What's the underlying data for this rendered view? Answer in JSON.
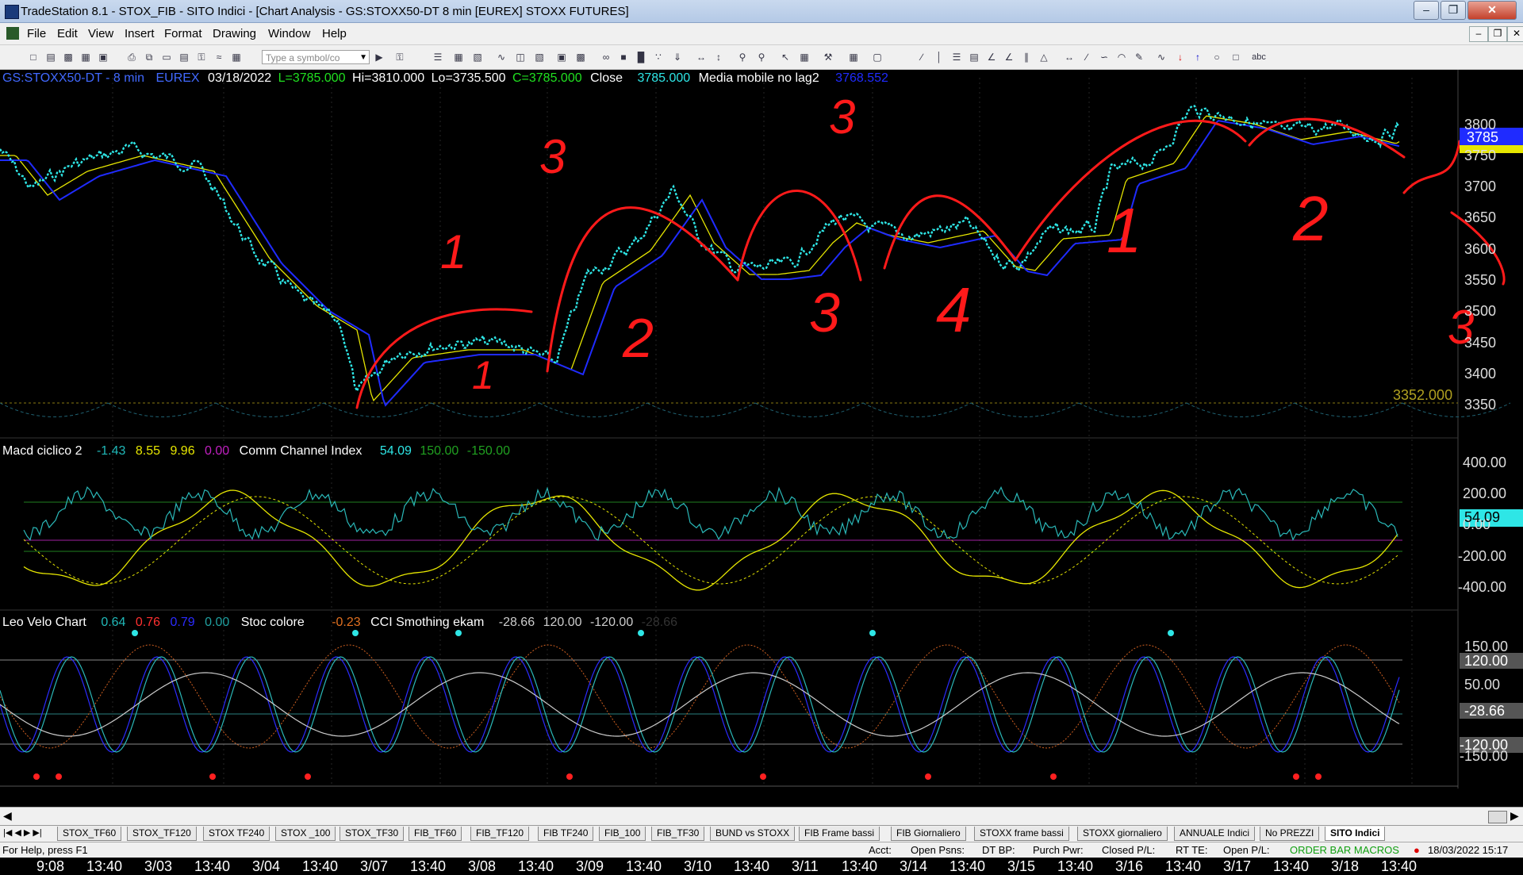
{
  "window": {
    "title": "TradeStation 8.1 - STOX_FIB - SITO Indici - [Chart Analysis - GS:STOXX50-DT  8 min  [EUREX] STOXX FUTURES]"
  },
  "menu": [
    "File",
    "Edit",
    "View",
    "Insert",
    "Format",
    "Drawing",
    "Window",
    "Help"
  ],
  "toolbar": {
    "symbol_placeholder": "Type a symbol/co"
  },
  "price_header": {
    "symbol": "GS:STOXX50-DT - 8 min",
    "exchange": "EUREX",
    "date": "03/18/2022",
    "last": "L=3785.000",
    "high": "Hi=3810.000",
    "low": "Lo=3735.500",
    "close_eq": "C=3785.000",
    "close_label": "Close",
    "close_val": "3785.000",
    "ma_label": "Media mobile no lag2",
    "ma_val": "3768.552"
  },
  "price_axis": [
    "3800",
    "3750",
    "3700",
    "3650",
    "3600",
    "3550",
    "3500",
    "3450",
    "3400",
    "3350"
  ],
  "price_marker": "3785",
  "level_label": "3352.000",
  "macd_header": {
    "name": "Macd ciclico 2",
    "v1": "-1.43",
    "v2": "8.55",
    "v3": "9.96",
    "v4": "0.00",
    "cci_name": "Comm Channel Index",
    "cci_v": "54.09",
    "cci_hi": "150.00",
    "cci_lo": "-150.00"
  },
  "macd_axis": [
    "400.00",
    "200.00",
    "0.00",
    "-200.00",
    "-400.00"
  ],
  "macd_marker": "54.09",
  "velo_header": {
    "name": "Leo Velo Chart",
    "v1": "0.64",
    "v2": "0.76",
    "v3": "0.79",
    "v4": "0.00",
    "stoc_name": "Stoc colore",
    "stoc_v": "-0.23",
    "cci2_name": "CCI Smothing ekam",
    "cci2_v": "-28.66",
    "cci2_hi": "120.00",
    "cci2_lo": "-120.00",
    "cci2_dim": "-28.66"
  },
  "velo_axis": [
    "150.00",
    "120.00",
    "50.00",
    "-28.66",
    "-120.00",
    "-150.00"
  ],
  "time_axis": [
    "9:08",
    "13:40",
    "3/03",
    "13:40",
    "3/04",
    "13:40",
    "3/07",
    "13:40",
    "3/08",
    "13:40",
    "3/09",
    "13:40",
    "3/10",
    "13:40",
    "3/11",
    "13:40",
    "3/14",
    "13:40",
    "3/15",
    "13:40",
    "3/16",
    "13:40",
    "3/17",
    "13:40",
    "3/18",
    "13:40"
  ],
  "tabs": [
    "STOX_TF60",
    "STOX_TF120",
    "STOX TF240",
    "STOX _100",
    "STOX_TF30",
    "FIB_TF60",
    "FIB_TF120",
    "FIB TF240",
    "FIB_100",
    "FIB_TF30",
    "BUND vs STOXX",
    "FIB Frame bassi",
    "FIB Giornaliero",
    "STOXX frame bassi",
    "STOXX giornaliero",
    "ANNUALE Indici",
    "No PREZZI",
    "SITO Indici"
  ],
  "status": {
    "help": "For Help, press F1",
    "acct": "Acct:",
    "open_psns": "Open Psns:",
    "dt_bp": "DT BP:",
    "purch_pwr": "Purch Pwr:",
    "closed_pl": "Closed P/L:",
    "rt_te": "RT TE:",
    "open_pl": "Open P/L:",
    "macros": "ORDER BAR  MACROS",
    "datetime": "18/03/2022 15:17"
  },
  "annotations": [
    "1",
    "1",
    "2",
    "3",
    "3",
    "4",
    "1",
    "2",
    "3",
    "3"
  ],
  "colors": {
    "price_line": "#2ee6e6",
    "ma_blue": "#1f2bff",
    "ma_yellow": "#e6e600",
    "annotation_red": "#ff1a1a",
    "macd_green": "#20c020"
  }
}
